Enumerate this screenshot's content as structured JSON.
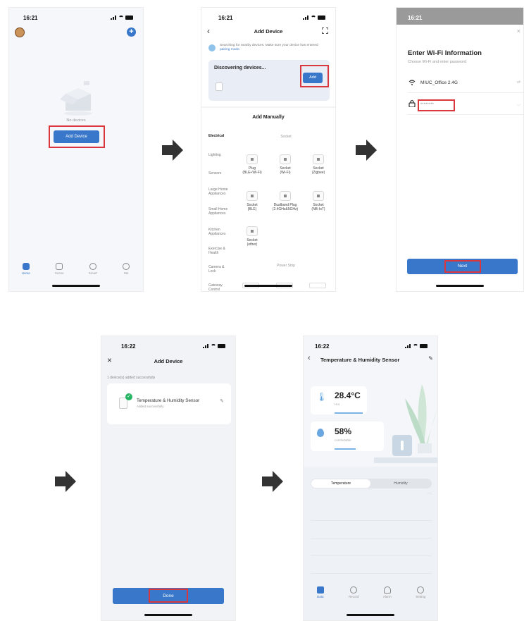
{
  "screen1": {
    "time": "16:21",
    "empty_text": "No devices",
    "add_device_button": "Add Device",
    "tabs": [
      {
        "label": "Home",
        "icon": "home-icon",
        "active": true
      },
      {
        "label": "Scene",
        "icon": "scene-icon",
        "active": false
      },
      {
        "label": "Smart",
        "icon": "smart-icon",
        "active": false
      },
      {
        "label": "Me",
        "icon": "me-icon",
        "active": false
      }
    ]
  },
  "screen2": {
    "time": "16:21",
    "title": "Add Device",
    "searching_text": "Searching for nearby devices. Make sure your device has entered",
    "pairing_link": "pairing mode.",
    "discovering_title": "Discovering devices...",
    "add_button": "Add",
    "add_manually_title": "Add Manually",
    "categories": [
      "Electrical",
      "Lighting",
      "Sensors",
      "Large Home Appliances",
      "Small Home Appliances",
      "Kitchen Appliances",
      "Exercise & Health",
      "Camera & Lock",
      "Gateway Control"
    ],
    "section_socket": "Socket",
    "section_power_strip": "Power Strip",
    "devices": [
      {
        "name": "Plug",
        "sub": "(BLE+Wi-Fi)"
      },
      {
        "name": "Socket",
        "sub": "(Wi-Fi)"
      },
      {
        "name": "Socket",
        "sub": "(Zigbee)"
      },
      {
        "name": "Socket",
        "sub": "(BLE)"
      },
      {
        "name": "Dualband Plug",
        "sub": "(2.4GHz&5GHz)"
      },
      {
        "name": "Socket",
        "sub": "(NB-IoT)"
      },
      {
        "name": "Socket",
        "sub": "(other)"
      }
    ]
  },
  "screen3": {
    "time": "16:21",
    "title": "Enter Wi-Fi Information",
    "subtitle": "Choose Wi-Fi and enter password",
    "ssid": "MIUC_Office 2.4G",
    "password_mask": "••••••••",
    "next_button": "Next"
  },
  "screen4": {
    "time": "16:22",
    "title": "Add Device",
    "added_count_text": "1 device(s) added successfully",
    "device_name": "Temperature & Humidity Sensor",
    "device_status": "Added successfully",
    "done_button": "Done"
  },
  "screen5": {
    "time": "16:22",
    "title": "Temperature & Humidity Sensor",
    "temperature": "28.4°C",
    "temperature_label": "Hot",
    "humidity": "58%",
    "humidity_label": "comfortable",
    "tab_temperature": "Temperature",
    "tab_humidity": "Humidity",
    "nav_tabs": [
      "Data",
      "Record",
      "Alarm",
      "Setting"
    ]
  },
  "colors": {
    "accent_blue": "#3877c9",
    "highlight_red": "#d9363e",
    "success_green": "#27b463"
  }
}
